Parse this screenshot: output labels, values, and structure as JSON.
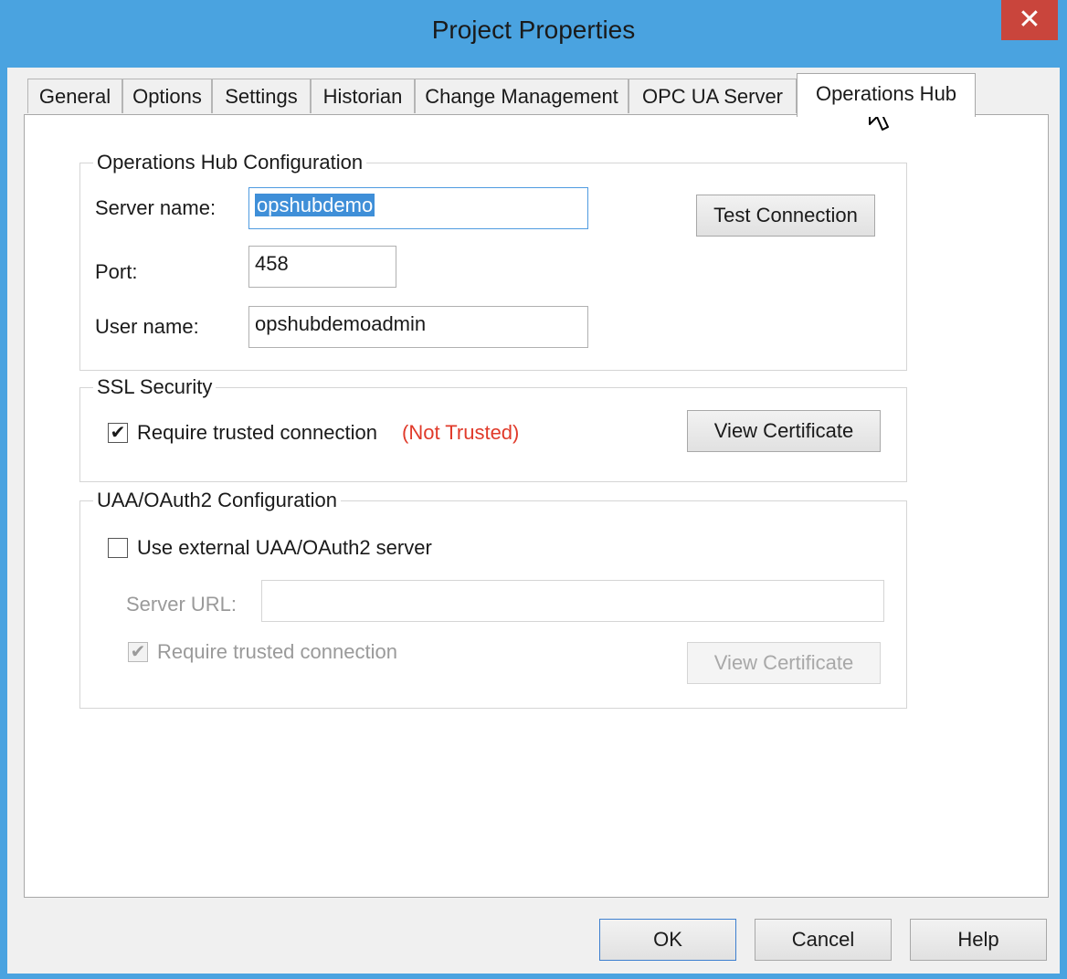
{
  "window": {
    "title": "Project Properties",
    "close_label": "✕"
  },
  "tabs": [
    {
      "label": "General"
    },
    {
      "label": "Options"
    },
    {
      "label": "Settings"
    },
    {
      "label": "Historian"
    },
    {
      "label": "Change Management"
    },
    {
      "label": "OPC UA Server"
    },
    {
      "label": "Operations Hub",
      "active": true
    }
  ],
  "ops_hub_config": {
    "legend": "Operations Hub Configuration",
    "server_name_label": "Server name:",
    "server_name_value": "opshubdemo",
    "port_label": "Port:",
    "port_value": "458",
    "user_name_label": "User name:",
    "user_name_value": "opshubdemoadmin",
    "test_connection_label": "Test Connection"
  },
  "ssl_security": {
    "legend": "SSL Security",
    "require_trusted_label": "Require trusted connection",
    "require_trusted_checked": true,
    "trust_status": "(Not Trusted)",
    "view_certificate_label": "View Certificate"
  },
  "uaa_oauth2": {
    "legend": "UAA/OAuth2 Configuration",
    "use_external_label": "Use external UAA/OAuth2 server",
    "use_external_checked": false,
    "server_url_label": "Server URL:",
    "server_url_value": "",
    "require_trusted_label": "Require trusted connection",
    "require_trusted_checked": true,
    "view_certificate_label": "View Certificate"
  },
  "footer": {
    "ok_label": "OK",
    "cancel_label": "Cancel",
    "help_label": "Help"
  },
  "colors": {
    "titlebar": "#4aa3e0",
    "close": "#c9453c",
    "warning": "#e03a2a",
    "selection": "#3f8fd8"
  }
}
